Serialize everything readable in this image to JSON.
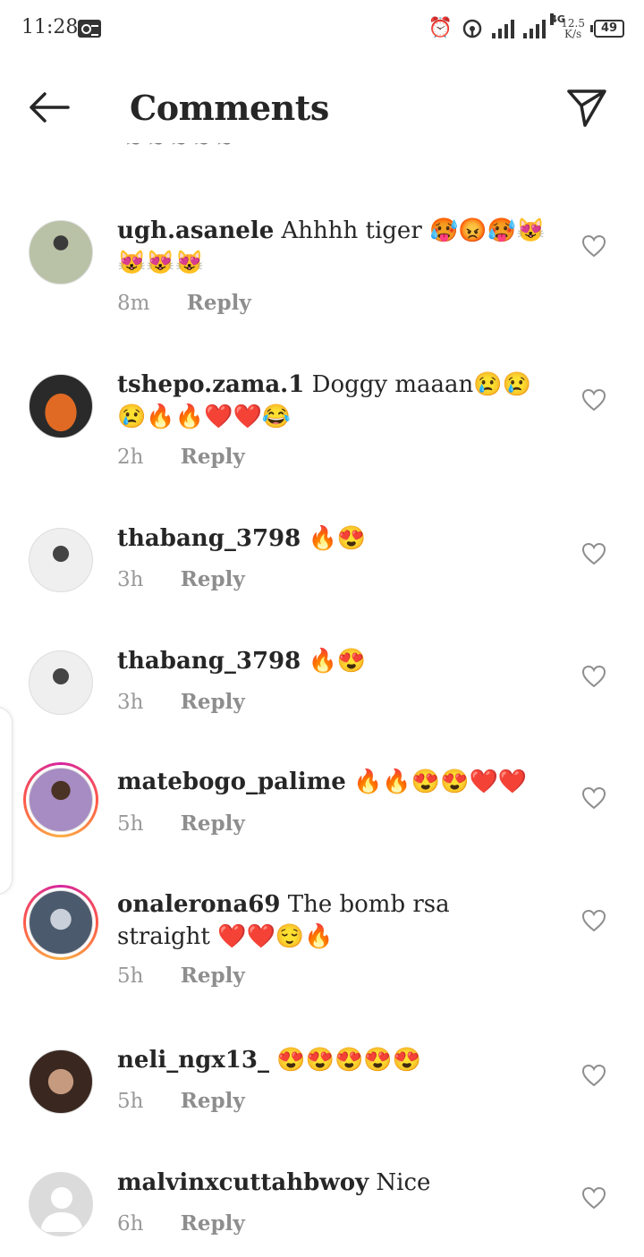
{
  "status_bar": {
    "time": "11:28",
    "network": "4G",
    "speed_value": "12.5",
    "speed_unit": "K/s",
    "battery": "49"
  },
  "header": {
    "title": "Comments",
    "back_icon": "arrow-left-icon",
    "send_icon": "paper-plane-icon"
  },
  "comments": [
    {
      "username": "ugh.asanele",
      "text": "Ahhhh tiger 🥵😡🥵😻😻😻😻",
      "time": "8m",
      "reply": "Reply",
      "avatar_color": "#8a9a7a",
      "story_ring": false
    },
    {
      "username": "tshepo.zama.1",
      "text": "Doggy maaan😢😢😢🔥🔥❤️❤️😂",
      "time": "2h",
      "reply": "Reply",
      "avatar_color": "#d4621f",
      "story_ring": false
    },
    {
      "username": "thabang_3798",
      "text": "🔥😍",
      "time": "3h",
      "reply": "Reply",
      "avatar_color": "#dcdcdc",
      "story_ring": false
    },
    {
      "username": "thabang_3798",
      "text": "🔥😍",
      "time": "3h",
      "reply": "Reply",
      "avatar_color": "#dcdcdc",
      "story_ring": false
    },
    {
      "username": "matebogo_palime",
      "text": "🔥🔥😍😍❤️❤️",
      "time": "5h",
      "reply": "Reply",
      "avatar_color": "#9a7fb0",
      "story_ring": true
    },
    {
      "username": "onalerona69",
      "text": "The bomb rsa straight ❤️❤️😌🔥",
      "time": "5h",
      "reply": "Reply",
      "avatar_color": "#5d6f86",
      "story_ring": true
    },
    {
      "username": "neli_ngx13_",
      "text": "😍😍😍😍😍",
      "time": "5h",
      "reply": "Reply",
      "avatar_color": "#6b4a3a",
      "story_ring": false
    },
    {
      "username": "malvinxcuttahbwoy",
      "text": "Nice",
      "time": "6h",
      "reply": "Reply",
      "avatar_color": "#d8d8d8",
      "story_ring": false
    }
  ]
}
